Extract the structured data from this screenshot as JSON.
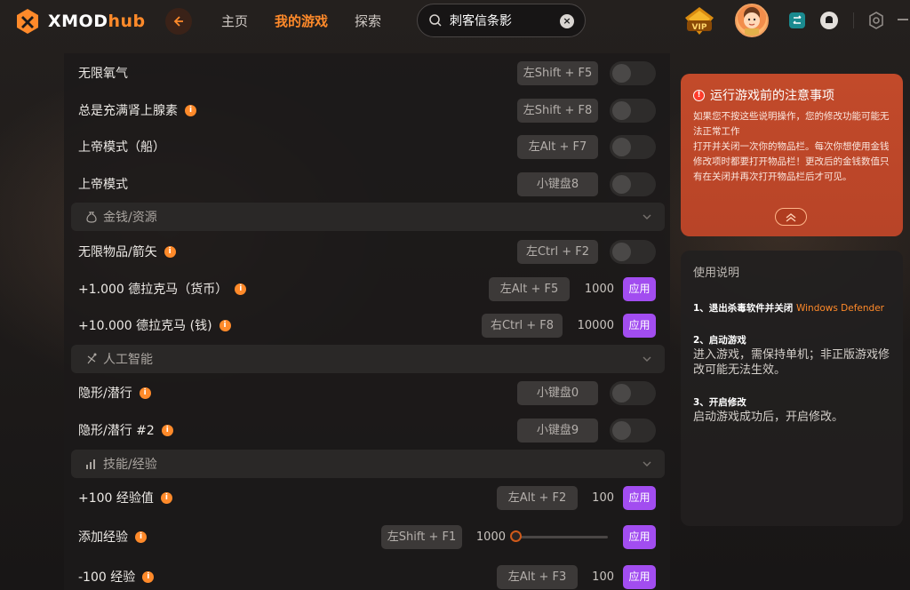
{
  "app": {
    "logo_text": "XMOD",
    "logo_accent": "hub"
  },
  "nav": {
    "items": [
      "主页",
      "我的游戏",
      "探索"
    ],
    "active_index": 1
  },
  "search": {
    "value": "刺客信条影"
  },
  "vip_label": "VIP",
  "colors": {
    "accent": "#ff8a2a",
    "apply": "#a24df0",
    "notice_bg": "#c24a2a"
  },
  "rows": [
    {
      "label": "无限氧气",
      "info": false,
      "hotkey": "左Shift + F5",
      "control": "toggle"
    },
    {
      "label": "总是充满肾上腺素",
      "info": true,
      "hotkey": "左Shift + F8",
      "control": "toggle"
    },
    {
      "label": "上帝模式（船）",
      "info": false,
      "hotkey": "左Alt + F7",
      "control": "toggle"
    },
    {
      "label": "上帝模式",
      "info": false,
      "hotkey": "小键盘8",
      "control": "toggle"
    }
  ],
  "sections": {
    "money": {
      "label": "金钱/资源",
      "icon": "money-bag-icon"
    },
    "ai": {
      "label": "人工智能",
      "icon": "ai-icon"
    },
    "skills": {
      "label": "技能/经验",
      "icon": "bar-chart-icon"
    }
  },
  "money_rows": [
    {
      "label": "无限物品/箭矢",
      "hotkey": "左Ctrl + F2",
      "control": "toggle"
    },
    {
      "label": "+1.000 德拉克马（货币）",
      "hotkey": "左Alt + F5",
      "value": "1000",
      "apply": "应用"
    },
    {
      "label": "+10.000 德拉克马 (钱)",
      "hotkey": "右Ctrl + F8",
      "value": "10000",
      "apply": "应用"
    }
  ],
  "ai_rows": [
    {
      "label": "隐形/潜行",
      "hotkey": "小键盘0",
      "control": "toggle"
    },
    {
      "label": "隐形/潜行 #2",
      "hotkey": "小键盘9",
      "control": "toggle"
    }
  ],
  "skill_rows": [
    {
      "label": "+100 经验值",
      "hotkey": "左Alt + F2",
      "value": "100",
      "apply": "应用"
    },
    {
      "label": "添加经验",
      "hotkey": "左Shift + F1",
      "value": "1000",
      "slider_fraction": 0,
      "apply": "应用"
    },
    {
      "label": "-100 经验",
      "hotkey": "左Alt + F3",
      "value": "100",
      "apply": "应用"
    }
  ],
  "notice": {
    "title": "运行游戏前的注意事项",
    "body_1": "如果您不按这些说明操作，您的修改功能可能无法正常工作",
    "body_2": "打开并关闭一次你的物品栏。每次你想使用金钱修改项时都要打开物品栏！更改后的金钱数值只有在关闭并再次打开物品栏后才可见。"
  },
  "help": {
    "title": "使用说明",
    "step1_head": "1、退出杀毒软件并关闭",
    "step1_highlight": "Windows Defender",
    "step2_head": "2、启动游戏",
    "step2_body": "进入游戏，需保持单机；非正版游戏修改可能无法生效。",
    "step3_head": "3、开启修改",
    "step3_body": "启动游戏成功后，开启修改。"
  }
}
